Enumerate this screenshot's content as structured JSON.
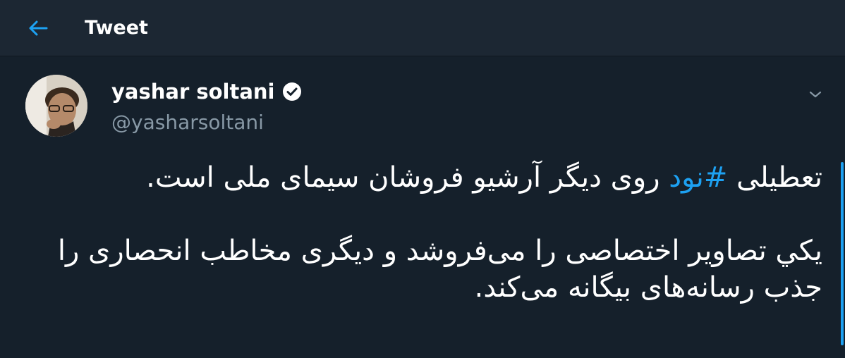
{
  "header": {
    "back_icon": "arrow-left-icon",
    "title": "Tweet"
  },
  "colors": {
    "background": "#15202b",
    "header_background": "#1c2733",
    "accent": "#1da1f2",
    "secondary_text": "#8899a6"
  },
  "tweet": {
    "author_name": "yashar soltani",
    "author_handle": "@yasharsoltani",
    "verified_icon": "verified-badge-icon",
    "menu_icon": "chevron-down-icon",
    "text": {
      "line1_before": "تعطیلی ",
      "hashtag": "#نود",
      "line1_after": " روی دیگر آرشیو فروشان سیمای ملی است.",
      "paragraph2": "يكي تصاویر اختصاصی را می‌فروشد و دیگری مخاطب انحصاری را جذب رسانه‌های بیگانه می‌کند."
    }
  }
}
